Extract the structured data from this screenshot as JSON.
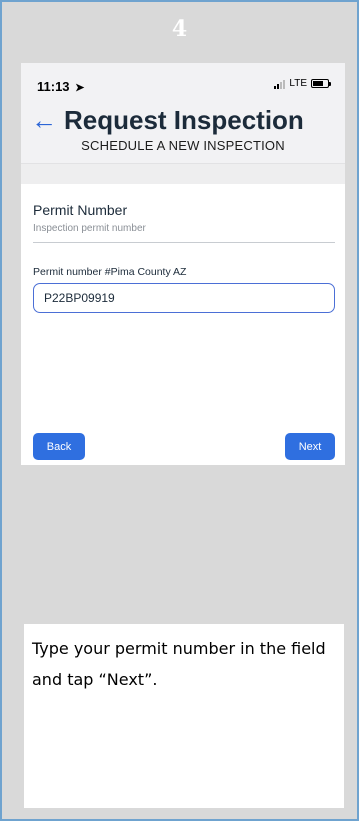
{
  "step_number": "4",
  "status_bar": {
    "time": "11:13",
    "location_arrow": "➤",
    "network": "LTE"
  },
  "header": {
    "back_icon": "←",
    "title": "Request Inspection",
    "subtitle": "SCHEDULE A NEW INSPECTION"
  },
  "form": {
    "section_label": "Permit Number",
    "section_help": "Inspection permit number",
    "field_label": "Permit number #Pima County AZ",
    "field_value": "P22BP09919"
  },
  "buttons": {
    "back": "Back",
    "next": "Next"
  },
  "caption": "Type your permit number in the field and tap “Next”.",
  "colors": {
    "frame_bg": "#d9d9d9",
    "frame_border": "#6fa3cf",
    "accent": "#2f6fe0",
    "input_border": "#4b6fd6"
  }
}
